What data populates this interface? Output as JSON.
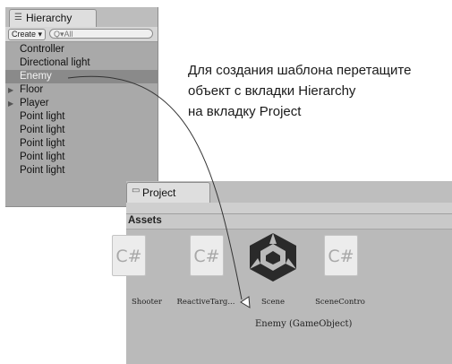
{
  "hierarchy": {
    "tab_label": "Hierarchy",
    "create_label": "Create ▾",
    "search_placeholder": "Q▾All",
    "items": [
      {
        "label": "Controller",
        "selected": false,
        "expandable": false
      },
      {
        "label": "Directional light",
        "selected": false,
        "expandable": false
      },
      {
        "label": "Enemy",
        "selected": true,
        "expandable": false
      },
      {
        "label": "Floor",
        "selected": false,
        "expandable": true
      },
      {
        "label": "Player",
        "selected": false,
        "expandable": true
      },
      {
        "label": "Point light",
        "selected": false,
        "expandable": false
      },
      {
        "label": "Point light",
        "selected": false,
        "expandable": false
      },
      {
        "label": "Point light",
        "selected": false,
        "expandable": false
      },
      {
        "label": "Point light",
        "selected": false,
        "expandable": false
      },
      {
        "label": "Point light",
        "selected": false,
        "expandable": false
      }
    ]
  },
  "instruction": {
    "line1": "Для создания шаблона перетащите",
    "line2": "объект с вкладки Hierarchy",
    "line3": "на вкладку Project"
  },
  "project": {
    "tab_label": "Project",
    "assets_label": "Assets",
    "items": [
      {
        "label": "Shooter",
        "icon": "csharp-script-icon"
      },
      {
        "label": "ReactiveTarg...",
        "icon": "csharp-script-icon"
      },
      {
        "label": "Scene",
        "icon": "unity-scene-icon"
      },
      {
        "label": "SceneContro",
        "icon": "csharp-script-icon"
      }
    ],
    "drag_label": "Enemy (GameObject)"
  },
  "colors": {
    "selection": "#8a8a8a",
    "panel": "#a9a9a9",
    "script_glyph": "#a8a8a8"
  }
}
